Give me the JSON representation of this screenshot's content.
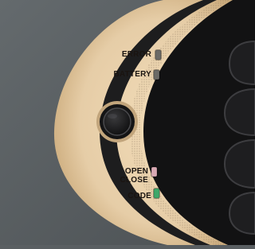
{
  "indicators": {
    "error": {
      "label": "ERROR",
      "led_color": "#6b6a66"
    },
    "battery": {
      "label": "BATTERY",
      "led_color": "#6b6a66"
    },
    "open": {
      "label": "OPEN",
      "led_color": "#d8a9b3"
    },
    "close": {
      "label": "CLOSE"
    },
    "code": {
      "label": "CODE",
      "led_color": "#3fa86a"
    }
  },
  "colors": {
    "panel": "#e6cda7",
    "panel_shadow": "#b38f64",
    "housing": "#1b1b1c",
    "wall": "#5a5f62"
  }
}
